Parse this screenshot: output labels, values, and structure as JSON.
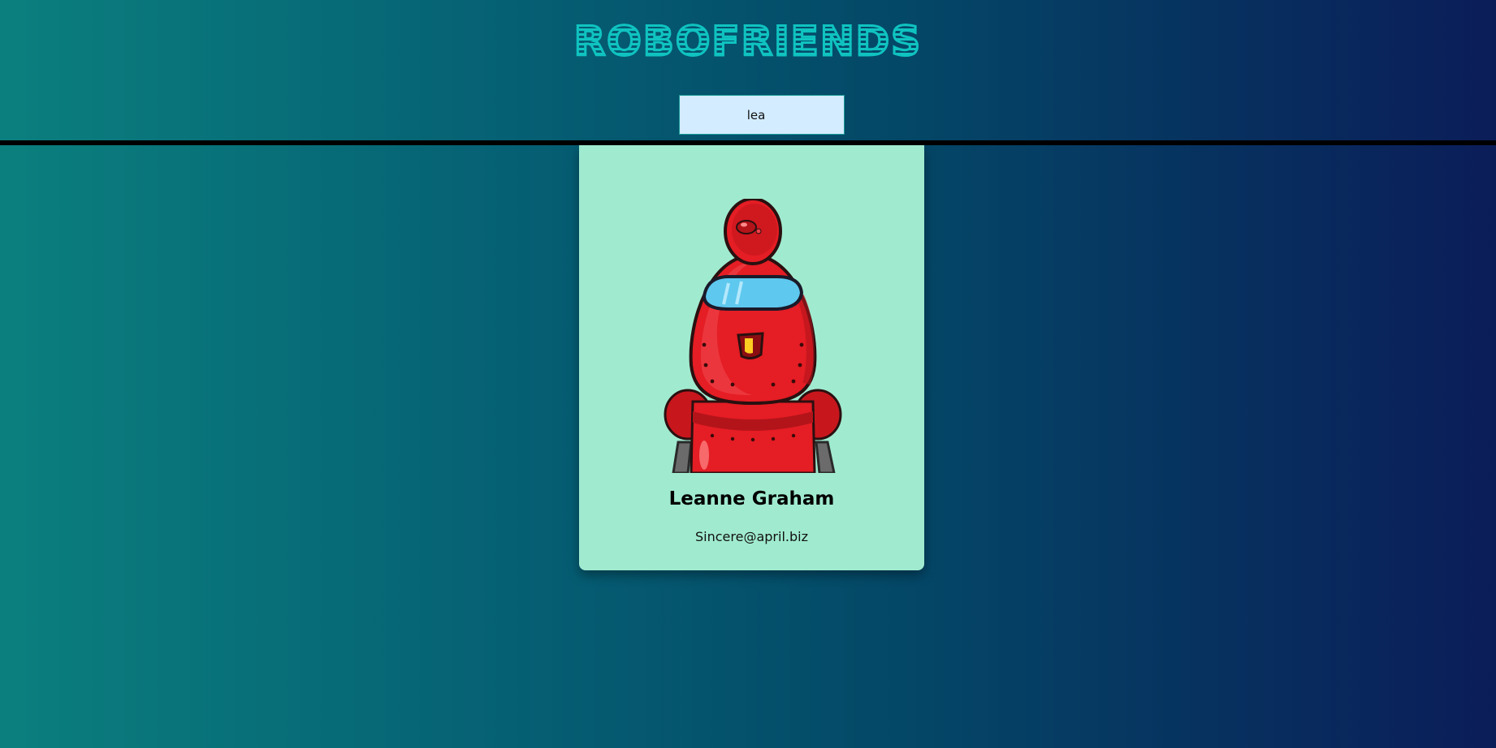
{
  "app": {
    "title": "ROBOFRIENDS"
  },
  "search": {
    "value": "lea"
  },
  "robots": [
    {
      "name": "Leanne Graham",
      "email": "Sincere@april.biz",
      "avatar_icon": "red-robot-avatar"
    }
  ],
  "colors": {
    "title": "#0fc3c0",
    "card_background": "#a0ebd0",
    "search_background": "#d3ecff",
    "gradient_left": "#0b7f7e",
    "gradient_right": "#0b1d59"
  }
}
